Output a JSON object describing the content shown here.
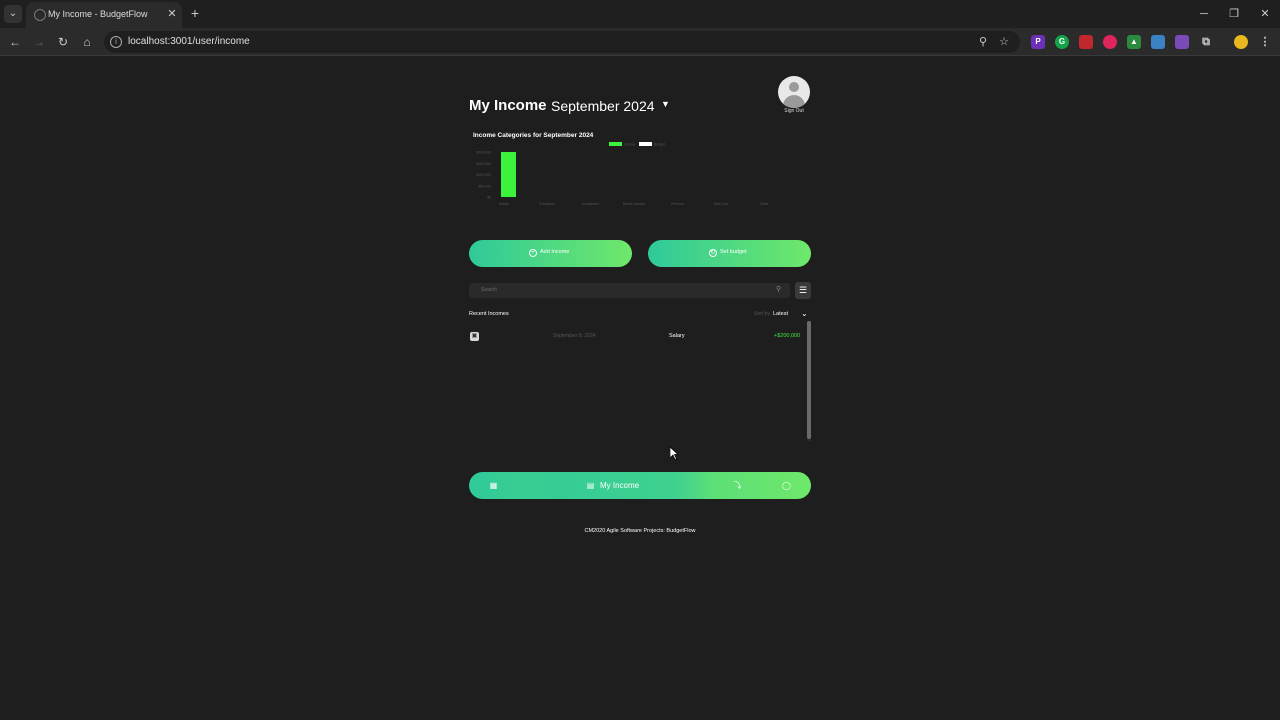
{
  "browser": {
    "tab_title": "My Income - BudgetFlow",
    "url": "localhost:3001/user/income"
  },
  "header": {
    "title": "My Income",
    "month": "September 2024",
    "sign_out": "Sign Out"
  },
  "chart_data": {
    "type": "bar",
    "title": "Income Categories for September 2024",
    "categories": [
      "Salary",
      "Freelance",
      "Investment",
      "Rental Income",
      "Pension",
      "Side Job",
      "Other"
    ],
    "series": [
      {
        "name": "Income",
        "values": [
          200000,
          0,
          0,
          0,
          0,
          0,
          0
        ],
        "color": "#3df23d"
      },
      {
        "name": "Budget",
        "values": [
          0,
          0,
          0,
          0,
          0,
          0,
          0
        ],
        "color": "#ffffff"
      }
    ],
    "y_ticks": [
      "$200,000",
      "$150,000",
      "$100,000",
      "$50,000",
      "$0"
    ],
    "ylim": [
      0,
      200000
    ]
  },
  "actions": {
    "add_income": "Add Income",
    "set_budget": "Set budget"
  },
  "search": {
    "placeholder": "Search"
  },
  "list": {
    "heading": "Recent Incomes",
    "sort_label": "Sort by",
    "sort_value": "Latest",
    "rows": [
      {
        "date": "September 8, 2024",
        "category": "Salary",
        "amount": "+$200,000"
      }
    ]
  },
  "bottom_nav": {
    "active_label": "My Income"
  },
  "footer": {
    "text": "CM2020 Agile Software Projects: BudgetFlow"
  },
  "colors": {
    "accent_start": "#2fc99a",
    "accent_end": "#6fe86a",
    "income_green": "#3df23d"
  }
}
